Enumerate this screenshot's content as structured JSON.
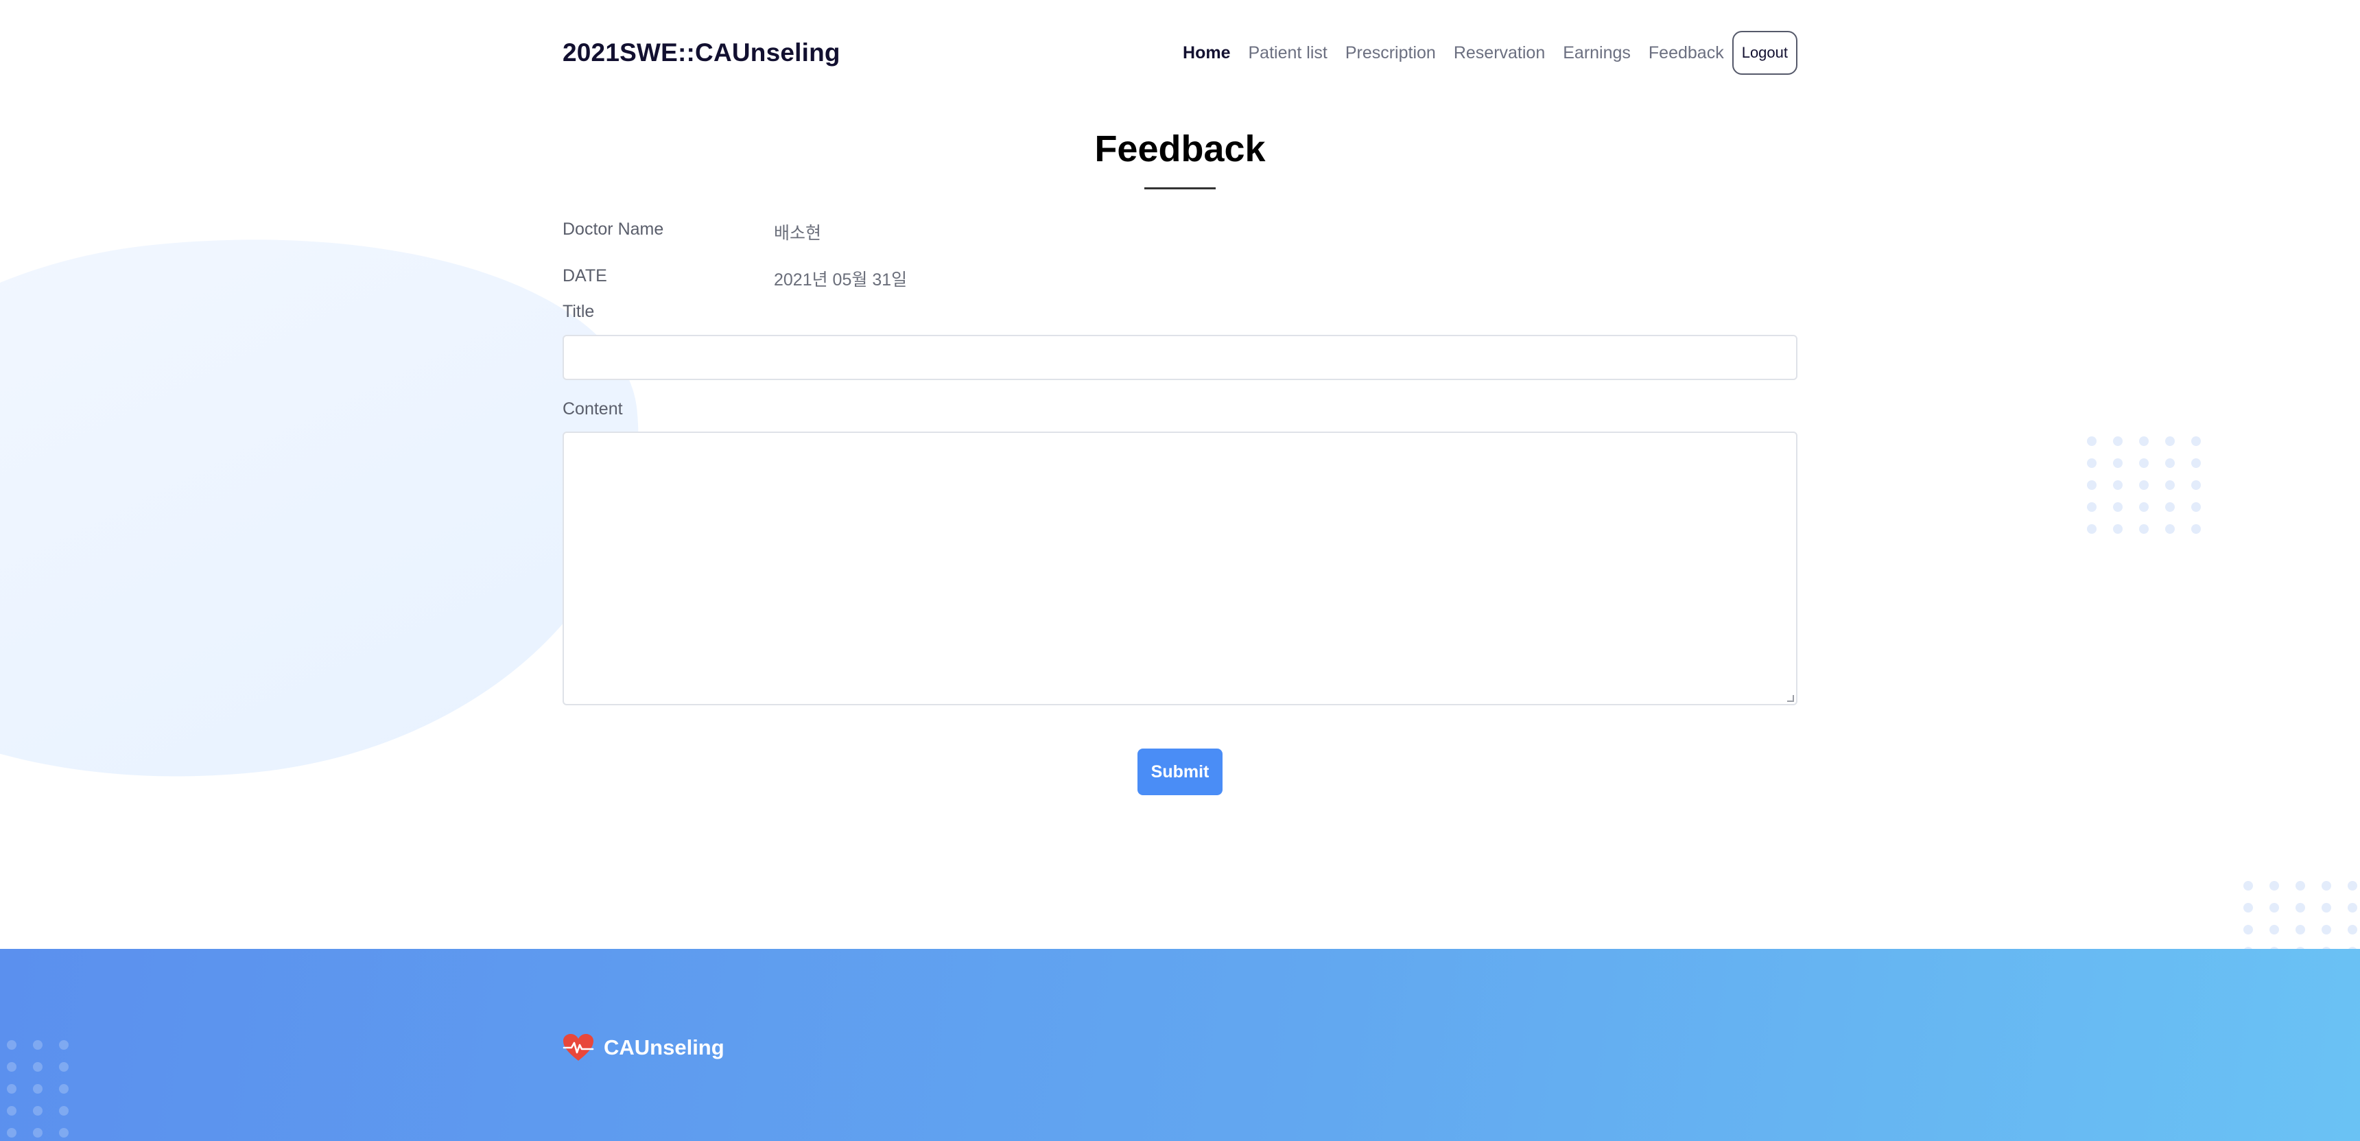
{
  "header": {
    "brand": "2021SWE::CAUnseling",
    "nav": {
      "home": "Home",
      "patient_list": "Patient list",
      "prescription": "Prescription",
      "reservation": "Reservation",
      "earnings": "Earnings",
      "feedback": "Feedback"
    },
    "logout_label": "Logout"
  },
  "main": {
    "title": "Feedback",
    "doctor_name_label": "Doctor Name",
    "doctor_name_value": "배소현",
    "date_label": "DATE",
    "date_value": "2021년 05월 31일",
    "title_field_label": "Title",
    "title_field_value": "",
    "content_field_label": "Content",
    "content_field_value": "",
    "submit_label": "Submit"
  },
  "footer": {
    "brand": "CAUnseling",
    "logo_icon": "heart-pulse-icon"
  },
  "colors": {
    "accent": "#4a8df6",
    "footer_gradient_start": "#5b90ee",
    "footer_gradient_end": "#6ac2f4",
    "heart": "#e8473a"
  }
}
